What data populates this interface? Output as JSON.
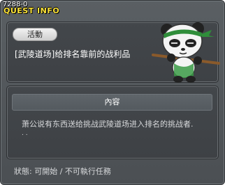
{
  "window": {
    "quest_id": "7288-0",
    "title": "QUEST INFO"
  },
  "quest": {
    "category": "活動",
    "name": "[武陵道场]给排名靠前的战利品",
    "character_icon": "panda-warrior-icon"
  },
  "content": {
    "header": "內容",
    "description": "萧公说有东西送给挑战武陵道场进入排名的挑战者.",
    "ellipsis": ". ."
  },
  "status": {
    "text": "狀態: 可開始 / 不可執行任務"
  }
}
